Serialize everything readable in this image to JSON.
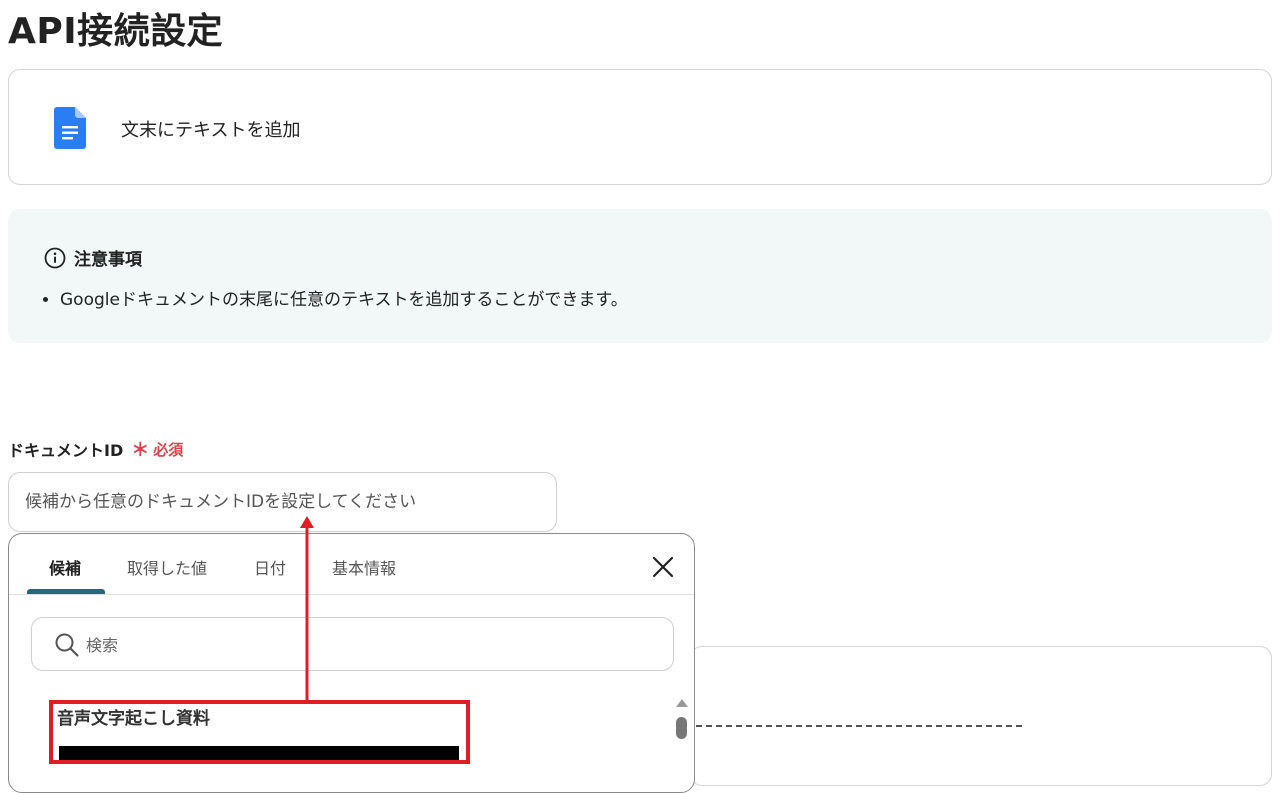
{
  "page": {
    "title": "API接続設定"
  },
  "action": {
    "label": "文末にテキストを追加",
    "icon": "google-docs-icon"
  },
  "notice": {
    "title": "注意事項",
    "icon": "info-icon",
    "items": [
      "Googleドキュメントの末尾に任意のテキストを追加することができます。"
    ]
  },
  "field": {
    "label": "ドキュメントID",
    "required_mark": "＊",
    "required_text": "必須",
    "placeholder": "候補から任意のドキュメントIDを設定してください",
    "value": ""
  },
  "dropdown": {
    "tabs": [
      {
        "label": "候補",
        "active": true
      },
      {
        "label": "取得した値",
        "active": false
      },
      {
        "label": "日付",
        "active": false
      },
      {
        "label": "基本情報",
        "active": false
      }
    ],
    "search": {
      "placeholder": "検索",
      "value": ""
    },
    "results": [
      {
        "title": "音声文字起こし資料"
      }
    ]
  },
  "colors": {
    "accent": "#1e6f7a",
    "required": "#e0424b",
    "highlight": "#e01c24",
    "notice_bg": "#f1f8f7",
    "doc_icon": "#2a7ef4"
  }
}
